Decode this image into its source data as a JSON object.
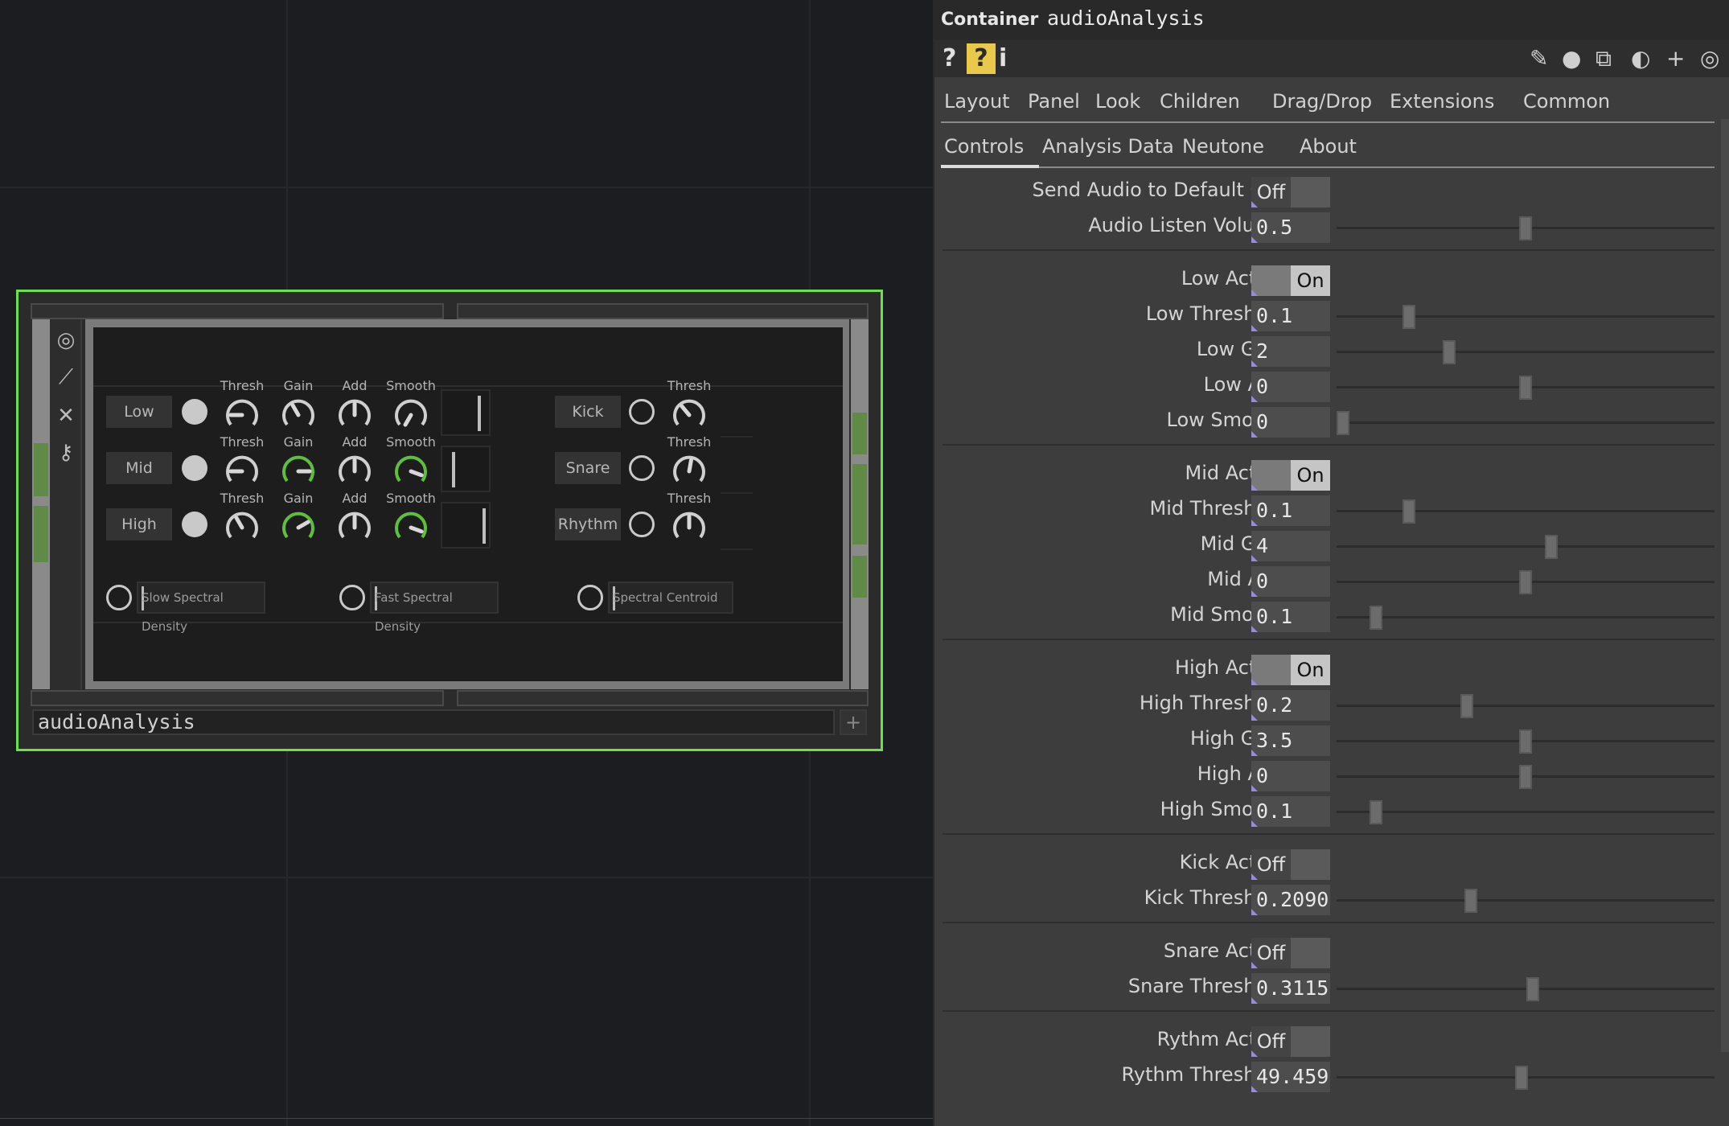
{
  "network": {
    "component_name": "audioAnalysis",
    "component_plus_icon": "plus-icon",
    "tools": [
      "target-icon",
      "pulse-icon",
      "close-icon",
      "lock-icon"
    ],
    "bands": [
      {
        "label": "Low",
        "knobs": [
          "Thresh",
          "Gain",
          "Add",
          "Smooth"
        ]
      },
      {
        "label": "Mid",
        "knobs": [
          "Thresh",
          "Gain",
          "Add",
          "Smooth"
        ]
      },
      {
        "label": "High",
        "knobs": [
          "Thresh",
          "Gain",
          "Add",
          "Smooth"
        ]
      }
    ],
    "beats": [
      {
        "label": "Kick",
        "knob": "Thresh"
      },
      {
        "label": "Snare",
        "knob": "Thresh"
      },
      {
        "label": "Rhythm",
        "knob": "Thresh"
      }
    ],
    "spectral": [
      "Slow Spectral Density",
      "Fast Spectral Density",
      "Spectral Centroid"
    ]
  },
  "header": {
    "type_label": "Container",
    "op_name": "audioAnalysis",
    "left_icons": [
      "help-icon",
      "python-help-icon",
      "info-icon"
    ],
    "right_icons": [
      "pencil-icon",
      "comment-icon",
      "clone-icon",
      "python-icon",
      "add-icon",
      "target-icon"
    ],
    "left_icon_glyphs": [
      "?",
      "?",
      "i"
    ],
    "right_icon_glyphs": [
      "✎",
      "●",
      "⧉",
      "◐",
      "+",
      "◎"
    ]
  },
  "tabs_row1": [
    "Layout",
    "Panel",
    "Look",
    "Children",
    "Drag/Drop",
    "Extensions",
    "Common"
  ],
  "tabs_row2": [
    "Controls",
    "Analysis Data",
    "Neutone",
    "About"
  ],
  "selected_tab": "Controls",
  "params": [
    {
      "label": "Send Audio to Default Out",
      "kind": "toggle",
      "value": "Off"
    },
    {
      "label": "Audio Listen Volume",
      "kind": "number",
      "value": "0.5",
      "slider": 0.5
    },
    {
      "label": "Low Active",
      "kind": "toggle",
      "value": "On"
    },
    {
      "label": "Low Threshold",
      "kind": "number",
      "value": "0.1",
      "slider": 0.18
    },
    {
      "label": "Low Gain",
      "kind": "number",
      "value": "2",
      "slider": 0.29
    },
    {
      "label": "Low Add",
      "kind": "number",
      "value": "0",
      "slider": 0.5
    },
    {
      "label": "Low Smooth",
      "kind": "number",
      "value": "0",
      "slider": 0.0
    },
    {
      "label": "Mid Active",
      "kind": "toggle",
      "value": "On"
    },
    {
      "label": "Mid Threshold",
      "kind": "number",
      "value": "0.1",
      "slider": 0.18
    },
    {
      "label": "Mid Gain",
      "kind": "number",
      "value": "4",
      "slider": 0.57
    },
    {
      "label": "Mid Add",
      "kind": "number",
      "value": "0",
      "slider": 0.5
    },
    {
      "label": "Mid Smooth",
      "kind": "number",
      "value": "0.1",
      "slider": 0.09
    },
    {
      "label": "High Active",
      "kind": "toggle",
      "value": "On"
    },
    {
      "label": "High Threshold",
      "kind": "number",
      "value": "0.2",
      "slider": 0.34
    },
    {
      "label": "High Gain",
      "kind": "number",
      "value": "3.5",
      "slider": 0.5
    },
    {
      "label": "High Add",
      "kind": "number",
      "value": "0",
      "slider": 0.5
    },
    {
      "label": "High Smooth",
      "kind": "number",
      "value": "0.1",
      "slider": 0.09
    },
    {
      "label": "Kick Active",
      "kind": "toggle",
      "value": "Off"
    },
    {
      "label": "Kick Threshold",
      "kind": "number",
      "value": "0.2090",
      "slider": 0.35
    },
    {
      "label": "Snare Active",
      "kind": "toggle",
      "value": "Off"
    },
    {
      "label": "Snare Threshold",
      "kind": "number",
      "value": "0.3115",
      "slider": 0.52
    },
    {
      "label": "Rythm Active",
      "kind": "toggle",
      "value": "Off"
    },
    {
      "label": "Rythm Threshold",
      "kind": "number",
      "value": "49.459",
      "slider": 0.49
    }
  ],
  "colors": {
    "accent_green": "#6fe04a",
    "knob_green": "#5fbf3a"
  }
}
